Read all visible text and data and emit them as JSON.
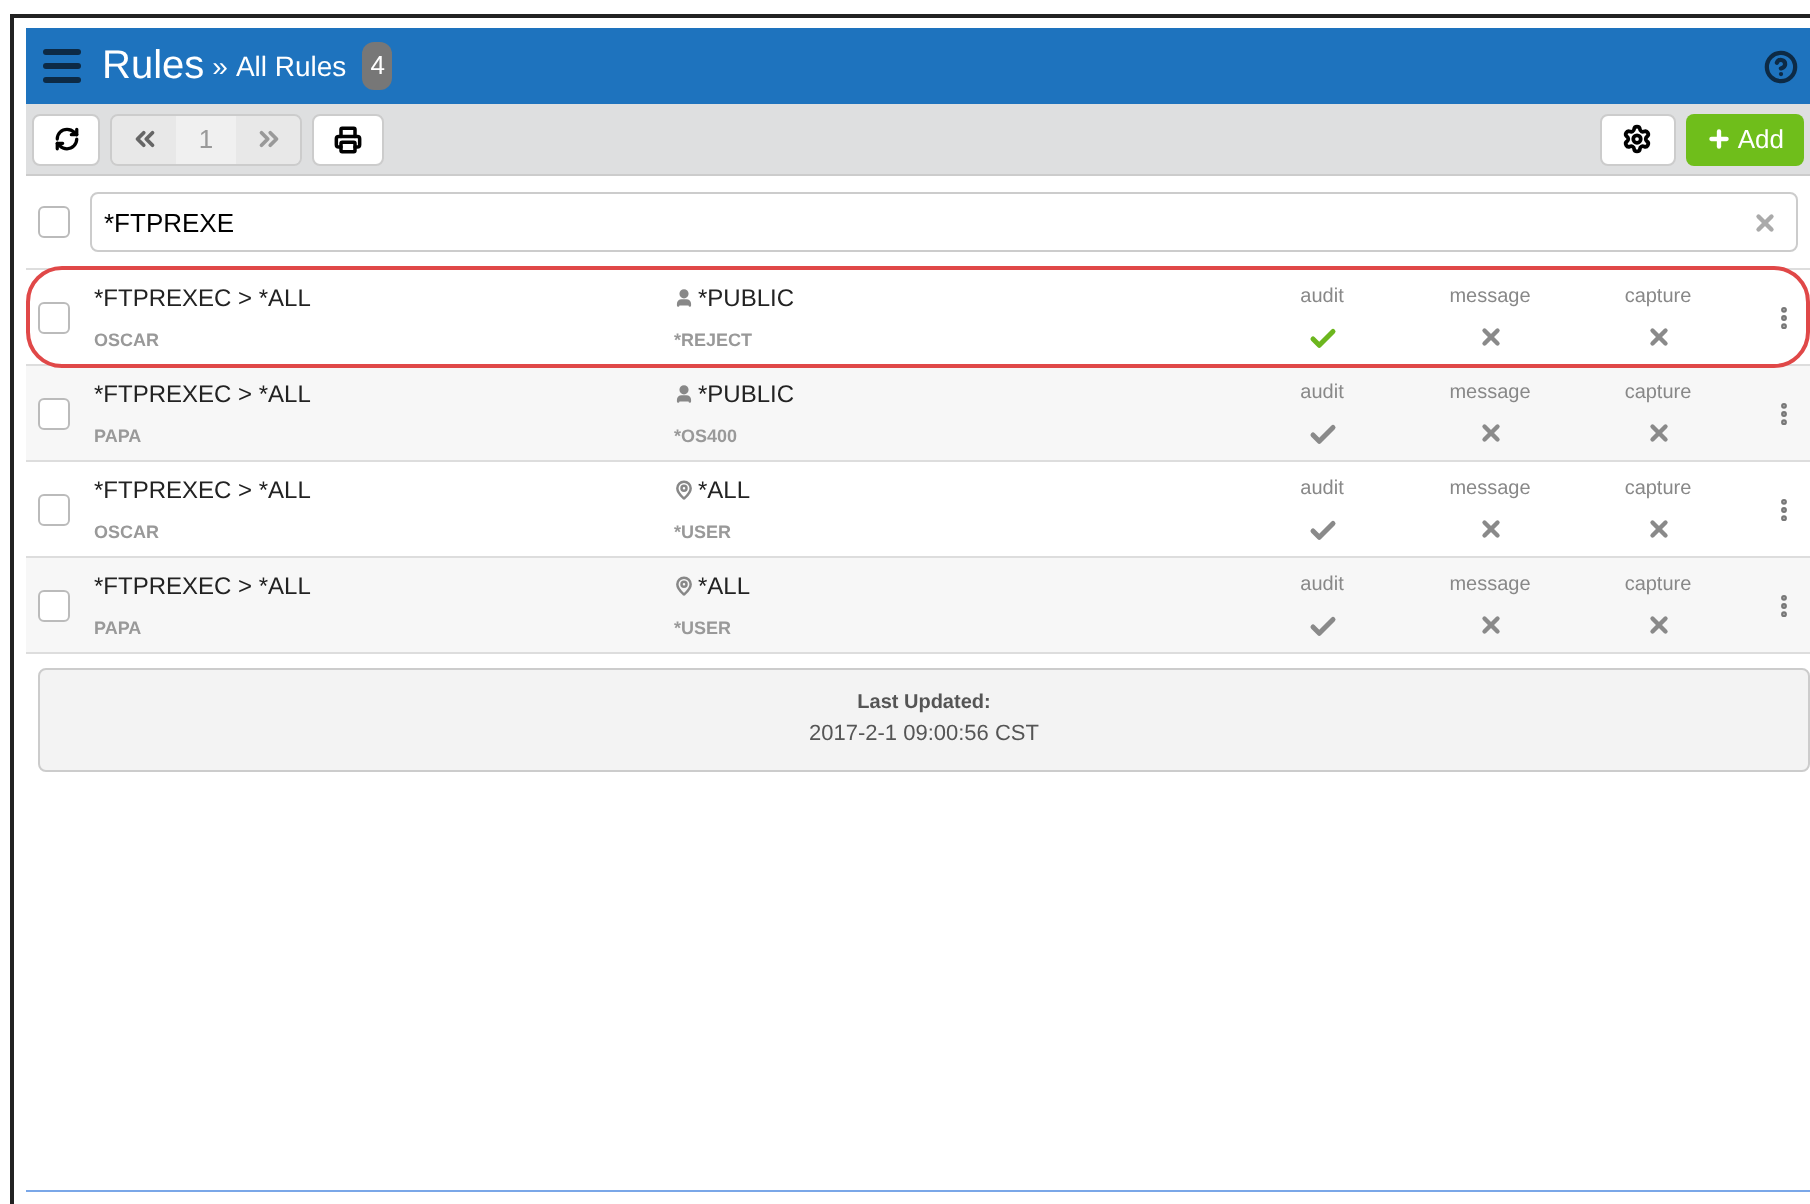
{
  "header": {
    "title": "Rules",
    "separator": "»",
    "subtitle": "All Rules",
    "count": "4"
  },
  "toolbar": {
    "page": "1",
    "add_label": "Add"
  },
  "search": {
    "value": "*FTPREXE",
    "checked": false
  },
  "rows": [
    {
      "name": "*FTPREXEC > *ALL",
      "server": "OSCAR",
      "kind": "user",
      "target": "*PUBLIC",
      "action": "*REJECT",
      "checked": false,
      "highlighted": true,
      "flags": [
        {
          "label": "audit",
          "kind": "check",
          "active": true
        },
        {
          "label": "message",
          "kind": "cross",
          "active": false
        },
        {
          "label": "capture",
          "kind": "cross",
          "active": false
        }
      ]
    },
    {
      "name": "*FTPREXEC > *ALL",
      "server": "PAPA",
      "kind": "user",
      "target": "*PUBLIC",
      "action": "*OS400",
      "checked": false,
      "highlighted": false,
      "flags": [
        {
          "label": "audit",
          "kind": "check",
          "active": false
        },
        {
          "label": "message",
          "kind": "cross",
          "active": false
        },
        {
          "label": "capture",
          "kind": "cross",
          "active": false
        }
      ]
    },
    {
      "name": "*FTPREXEC > *ALL",
      "server": "OSCAR",
      "kind": "location",
      "target": "*ALL",
      "action": "*USER",
      "checked": false,
      "highlighted": false,
      "flags": [
        {
          "label": "audit",
          "kind": "check",
          "active": false
        },
        {
          "label": "message",
          "kind": "cross",
          "active": false
        },
        {
          "label": "capture",
          "kind": "cross",
          "active": false
        }
      ]
    },
    {
      "name": "*FTPREXEC > *ALL",
      "server": "PAPA",
      "kind": "location",
      "target": "*ALL",
      "action": "*USER",
      "checked": false,
      "highlighted": false,
      "flags": [
        {
          "label": "audit",
          "kind": "check",
          "active": false
        },
        {
          "label": "message",
          "kind": "cross",
          "active": false
        },
        {
          "label": "capture",
          "kind": "cross",
          "active": false
        }
      ]
    }
  ],
  "footer": {
    "label": "Last Updated:",
    "timestamp": "2017-2-1 09:00:56 CST"
  }
}
